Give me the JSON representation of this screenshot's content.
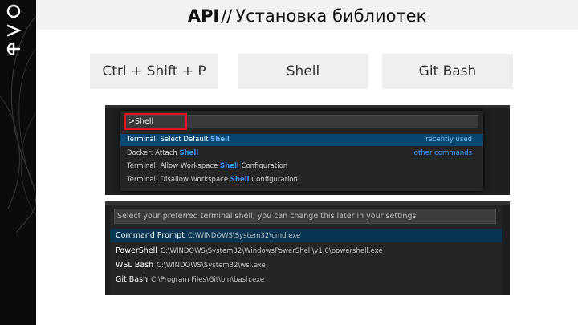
{
  "header": {
    "api": "API",
    "separator": "//",
    "title": "Установка библиотек"
  },
  "tags": [
    "Ctrl + Shift + P",
    "Shell",
    "Git Bash"
  ],
  "brand": {
    "logo_text": "evo"
  },
  "command_palette": {
    "input_value": ">Shell",
    "rows": [
      {
        "prefix": "Terminal: Select Default ",
        "match": "Shell",
        "suffix": "",
        "right": "recently used",
        "selected": true
      },
      {
        "prefix": "Docker: Attach ",
        "match": "Shell",
        "suffix": "",
        "right": "other commands",
        "selected": false
      },
      {
        "prefix": "Terminal: Allow Workspace ",
        "match": "Shell",
        "suffix": " Configuration",
        "right": "",
        "selected": false
      },
      {
        "prefix": "Terminal: Disallow Workspace ",
        "match": "Shell",
        "suffix": " Configuration",
        "right": "",
        "selected": false
      }
    ]
  },
  "shell_picker": {
    "placeholder": "Select your preferred terminal shell, you can change this later in your settings",
    "options": [
      {
        "name": "Command Prompt",
        "path": "C:\\WINDOWS\\System32\\cmd.exe",
        "selected": true
      },
      {
        "name": "PowerShell",
        "path": "C:\\WINDOWS\\System32\\WindowsPowerShell\\v1.0\\powershell.exe",
        "selected": false
      },
      {
        "name": "WSL Bash",
        "path": "C:\\WINDOWS\\System32\\wsl.exe",
        "selected": false
      },
      {
        "name": "Git Bash",
        "path": "C:\\Program Files\\Git\\bin\\bash.exe",
        "selected": false
      }
    ]
  },
  "colors": {
    "highlight_red": "#e81123",
    "vscode_blue": "#3794ff",
    "selection_bg": "#094771"
  }
}
